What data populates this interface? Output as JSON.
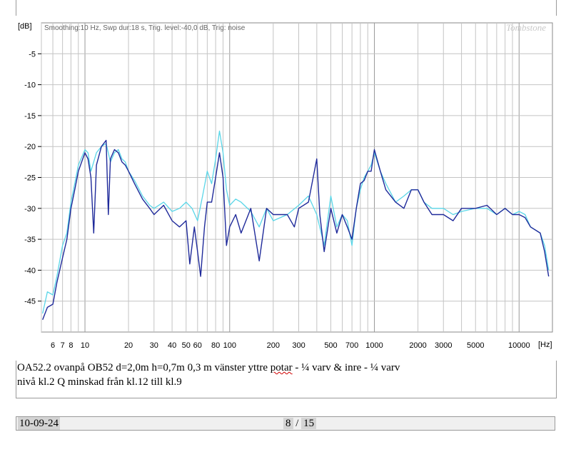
{
  "chart_data": {
    "type": "line",
    "title": "",
    "info": "Smoothing:10 Hz, Swp dur:18 s, Trig. level:-40,0 dB, Trig: noise",
    "watermark": "Tombstone",
    "xlabel": "[Hz]",
    "ylabel": "[dB]",
    "xscale": "log",
    "xlim": [
      5,
      17000
    ],
    "ylim": [
      -50,
      0
    ],
    "y_ticks": [
      -5,
      -10,
      -15,
      -20,
      -25,
      -30,
      -35,
      -40,
      -45
    ],
    "x_tick_labels": [
      "6",
      "7",
      "8",
      "10",
      "20",
      "30",
      "40",
      "50",
      "60",
      "80",
      "100",
      "200",
      "300",
      "500",
      "700",
      "1000",
      "2000",
      "3000",
      "5000",
      "10000"
    ],
    "x_tick_values": [
      6,
      7,
      8,
      10,
      20,
      30,
      40,
      50,
      60,
      80,
      100,
      200,
      300,
      500,
      700,
      1000,
      2000,
      3000,
      5000,
      10000
    ],
    "grid": true,
    "series": [
      {
        "color": "#5ad6e8",
        "points": [
          [
            5.1,
            -47
          ],
          [
            5.5,
            -43.5
          ],
          [
            6,
            -44
          ],
          [
            6.4,
            -41
          ],
          [
            7,
            -36
          ],
          [
            7.5,
            -34
          ],
          [
            8,
            -29
          ],
          [
            8.5,
            -26
          ],
          [
            9,
            -23
          ],
          [
            10,
            -20.5
          ],
          [
            10.5,
            -21
          ],
          [
            11,
            -24
          ],
          [
            12,
            -21
          ],
          [
            13,
            -20
          ],
          [
            14,
            -19.5
          ],
          [
            15,
            -22.5
          ],
          [
            16,
            -21
          ],
          [
            17,
            -20.5
          ],
          [
            18,
            -22
          ],
          [
            19,
            -22.5
          ],
          [
            20,
            -24
          ],
          [
            22,
            -25.5
          ],
          [
            25,
            -28
          ],
          [
            28,
            -29.5
          ],
          [
            30,
            -30
          ],
          [
            35,
            -29
          ],
          [
            40,
            -30.5
          ],
          [
            45,
            -30
          ],
          [
            50,
            -29
          ],
          [
            55,
            -30
          ],
          [
            60,
            -32
          ],
          [
            65,
            -28
          ],
          [
            70,
            -24
          ],
          [
            75,
            -26
          ],
          [
            80,
            -22
          ],
          [
            85,
            -17.5
          ],
          [
            90,
            -21
          ],
          [
            95,
            -27
          ],
          [
            100,
            -29.5
          ],
          [
            110,
            -28.5
          ],
          [
            120,
            -29
          ],
          [
            140,
            -30.5
          ],
          [
            160,
            -33
          ],
          [
            180,
            -30
          ],
          [
            200,
            -32
          ],
          [
            250,
            -31
          ],
          [
            300,
            -29.5
          ],
          [
            350,
            -28
          ],
          [
            400,
            -31
          ],
          [
            450,
            -36
          ],
          [
            500,
            -28
          ],
          [
            550,
            -33
          ],
          [
            600,
            -31
          ],
          [
            650,
            -32
          ],
          [
            700,
            -36
          ],
          [
            750,
            -30
          ],
          [
            800,
            -27
          ],
          [
            850,
            -25
          ],
          [
            900,
            -24
          ],
          [
            950,
            -23
          ],
          [
            1000,
            -21
          ],
          [
            1100,
            -24
          ],
          [
            1200,
            -26
          ],
          [
            1400,
            -29
          ],
          [
            1600,
            -28
          ],
          [
            1800,
            -27
          ],
          [
            2000,
            -27
          ],
          [
            2200,
            -29
          ],
          [
            2500,
            -30
          ],
          [
            3000,
            -30
          ],
          [
            3500,
            -31
          ],
          [
            4000,
            -30.5
          ],
          [
            5000,
            -30
          ],
          [
            6000,
            -30
          ],
          [
            7000,
            -31
          ],
          [
            8000,
            -30
          ],
          [
            9000,
            -31
          ],
          [
            10000,
            -30.5
          ],
          [
            11000,
            -31
          ],
          [
            12000,
            -33
          ],
          [
            14000,
            -34
          ],
          [
            15000,
            -36
          ],
          [
            16000,
            -40
          ]
        ]
      },
      {
        "color": "#1f2a9a",
        "points": [
          [
            5.1,
            -48
          ],
          [
            5.5,
            -46
          ],
          [
            6,
            -45.5
          ],
          [
            6.4,
            -42
          ],
          [
            7,
            -38
          ],
          [
            7.5,
            -35
          ],
          [
            8,
            -30
          ],
          [
            8.5,
            -27
          ],
          [
            9,
            -24
          ],
          [
            10,
            -21
          ],
          [
            10.5,
            -22
          ],
          [
            11,
            -25
          ],
          [
            11.5,
            -34
          ],
          [
            12,
            -23
          ],
          [
            13,
            -20
          ],
          [
            14,
            -19
          ],
          [
            14.5,
            -31
          ],
          [
            15,
            -22
          ],
          [
            16,
            -20.5
          ],
          [
            17,
            -21
          ],
          [
            18,
            -22.5
          ],
          [
            19,
            -23
          ],
          [
            20,
            -24
          ],
          [
            22,
            -26
          ],
          [
            25,
            -28.5
          ],
          [
            28,
            -30
          ],
          [
            30,
            -31
          ],
          [
            35,
            -29.5
          ],
          [
            40,
            -32
          ],
          [
            45,
            -33
          ],
          [
            50,
            -32
          ],
          [
            53,
            -39
          ],
          [
            57,
            -33
          ],
          [
            60,
            -37
          ],
          [
            63,
            -41
          ],
          [
            67,
            -33
          ],
          [
            70,
            -29
          ],
          [
            75,
            -29
          ],
          [
            80,
            -25
          ],
          [
            85,
            -21
          ],
          [
            90,
            -25
          ],
          [
            95,
            -36
          ],
          [
            100,
            -33
          ],
          [
            110,
            -31
          ],
          [
            120,
            -34
          ],
          [
            140,
            -30
          ],
          [
            160,
            -38.5
          ],
          [
            180,
            -30
          ],
          [
            200,
            -31
          ],
          [
            250,
            -31
          ],
          [
            280,
            -33
          ],
          [
            300,
            -30
          ],
          [
            350,
            -29
          ],
          [
            400,
            -22
          ],
          [
            420,
            -31
          ],
          [
            450,
            -37
          ],
          [
            500,
            -30
          ],
          [
            550,
            -34
          ],
          [
            600,
            -31
          ],
          [
            650,
            -33
          ],
          [
            700,
            -35
          ],
          [
            750,
            -30
          ],
          [
            800,
            -26
          ],
          [
            850,
            -25.5
          ],
          [
            900,
            -24
          ],
          [
            950,
            -24
          ],
          [
            1000,
            -20.5
          ],
          [
            1100,
            -24
          ],
          [
            1200,
            -27
          ],
          [
            1400,
            -29
          ],
          [
            1600,
            -30
          ],
          [
            1800,
            -27
          ],
          [
            2000,
            -27
          ],
          [
            2200,
            -29
          ],
          [
            2500,
            -31
          ],
          [
            3000,
            -31
          ],
          [
            3500,
            -32
          ],
          [
            4000,
            -30
          ],
          [
            5000,
            -30
          ],
          [
            6000,
            -29.5
          ],
          [
            7000,
            -31
          ],
          [
            8000,
            -30
          ],
          [
            9000,
            -31
          ],
          [
            10000,
            -31
          ],
          [
            11000,
            -31.5
          ],
          [
            12000,
            -33
          ],
          [
            14000,
            -34
          ],
          [
            15000,
            -37
          ],
          [
            16000,
            -41
          ]
        ]
      }
    ]
  },
  "caption": {
    "line1_part1": "OA52.2 ovanpå OB52   d=2,0m h=0,7m 0,3 m  vänster yttre ",
    "line1_spell": "potar",
    "line1_part2": " - ¼ varv & inre - ¼  varv",
    "line2": "nivå kl.2  Q minskad från kl.12 till kl.9"
  },
  "footer": {
    "date": "10-09-24",
    "page_current": "8",
    "page_separator": " / ",
    "page_total": "15"
  }
}
